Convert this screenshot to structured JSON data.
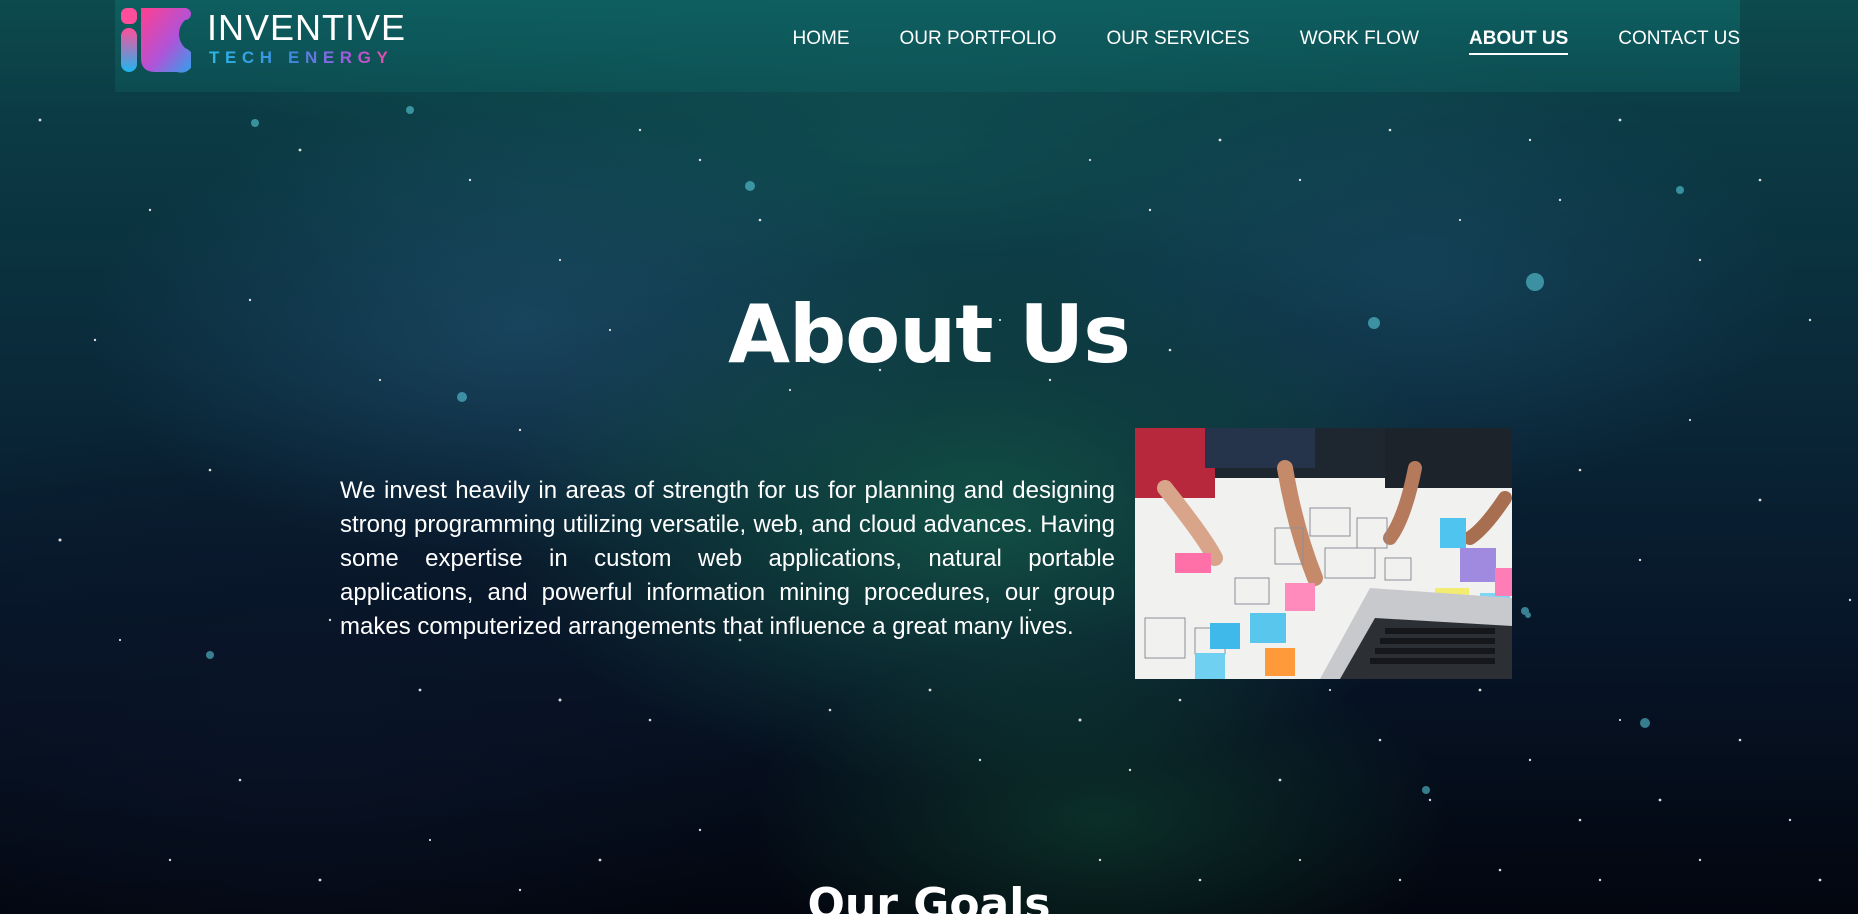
{
  "brand": {
    "name": "INVENTIVE",
    "tagline": "TECH ENERGY",
    "logo_icon": "it-monogram-logo",
    "colors": {
      "pink": "#f0478f",
      "blue": "#2fb2ea",
      "purple": "#8b58d8"
    }
  },
  "nav": {
    "items": [
      {
        "label": "HOME",
        "active": false
      },
      {
        "label": "OUR PORTFOLIO",
        "active": false
      },
      {
        "label": "OUR SERVICES",
        "active": false
      },
      {
        "label": "WORK FLOW",
        "active": false
      },
      {
        "label": "ABOUT US",
        "active": true
      },
      {
        "label": "CONTACT US",
        "active": false
      }
    ]
  },
  "hero": {
    "title": "About Us"
  },
  "about": {
    "paragraph": "We invest heavily in areas of strength for us for planning and designing strong programming utilizing versatile, web, and cloud advances. Having some expertise in custom web applications, natural portable applications, and powerful information mining procedures, our group makes computerized arrangements that influence a great many lives.",
    "image_icon": "team-planning-photo"
  },
  "goals": {
    "title": "Our Goals"
  },
  "theme": {
    "background": "#0b3a44",
    "nav_bar": "#0e6e6e",
    "text": "#ffffff"
  }
}
